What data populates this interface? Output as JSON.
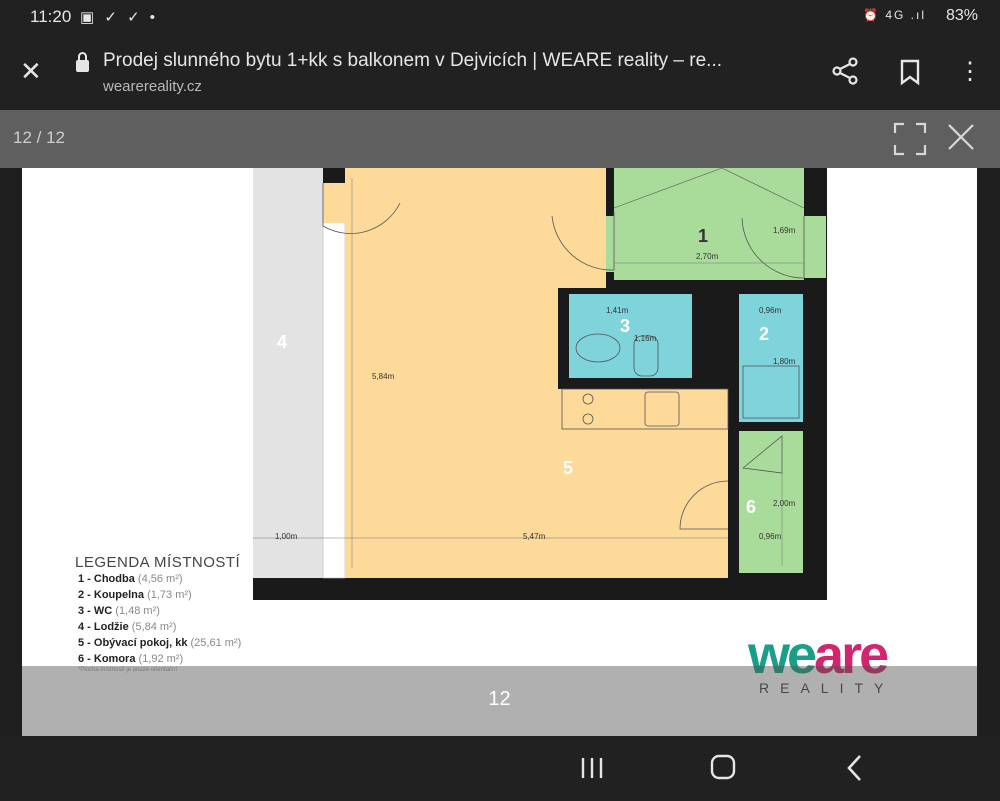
{
  "status": {
    "time": "11:20",
    "left_icons": "▣ ✓ ✓ •",
    "right_icons": "⏰ 4G .ıl",
    "battery": "83%"
  },
  "browser": {
    "title": "Prodej slunného bytu 1+kk s balkonem v Dejvicích | WEARE reality – re...",
    "domain": "weare­reality.cz"
  },
  "viewer": {
    "counter": "12 / 12",
    "caption": "12"
  },
  "plan": {
    "rooms": [
      {
        "id": "1",
        "label": "1"
      },
      {
        "id": "2",
        "label": "2"
      },
      {
        "id": "3",
        "label": "3"
      },
      {
        "id": "4",
        "label": "4"
      },
      {
        "id": "5",
        "label": "5"
      },
      {
        "id": "6",
        "label": "6"
      }
    ],
    "dims": {
      "d1": "1,69m",
      "d2": "2,70m",
      "d3": "1,41m",
      "d4": "1,16m",
      "d5": "0,96m",
      "d6": "1,80m",
      "d7": "5,84m",
      "d8": "2,00m",
      "d9": "1,00m",
      "d10": "5,47m",
      "d11": "0,96m"
    },
    "legend_title": "LEGENDA MÍSTNOSTÍ",
    "legend": [
      {
        "num": "1 - Chodba",
        "area": "(4,56 m²)"
      },
      {
        "num": "2 - Koupelna",
        "area": "(1,73 m²)"
      },
      {
        "num": "3 - WC",
        "area": "(1,48 m²)"
      },
      {
        "num": "4 - Lodžie",
        "area": "(5,84 m²)"
      },
      {
        "num": "5 - Obývací pokoj, kk",
        "area": "(25,61 m²)"
      },
      {
        "num": "6 - Komora",
        "area": "(1,92 m²)"
      }
    ],
    "legend_note": "*Plocha místností je pouze orientační",
    "logo": {
      "we": "we",
      "are": "are",
      "sub": "REALITY"
    }
  },
  "colors": {
    "green": "#a9dc9a",
    "cyan": "#7fd3da",
    "orange": "#fdd99a",
    "grey": "#e3e3e3",
    "logo_teal": "#1a9e8a",
    "logo_magenta": "#d1266f"
  }
}
